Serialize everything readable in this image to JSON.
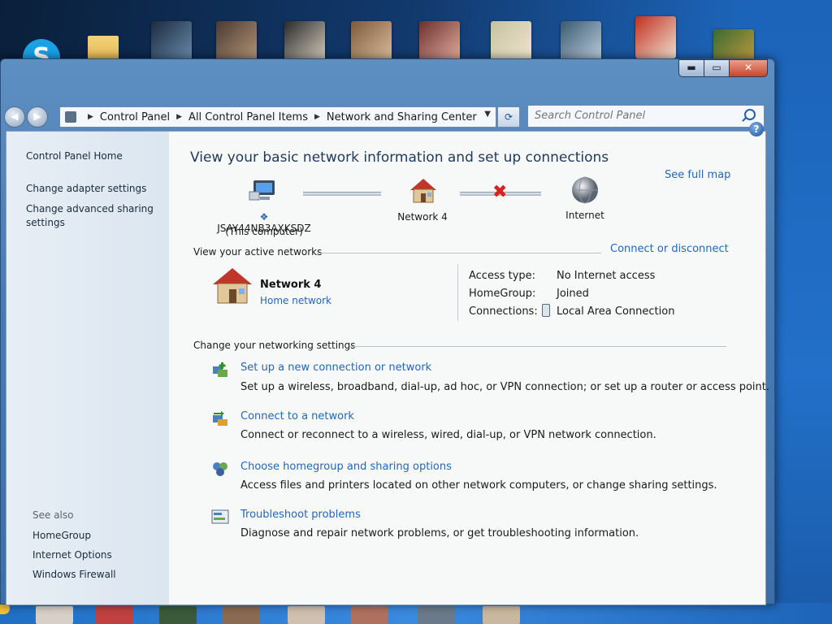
{
  "window": {
    "caption_buttons": {
      "minimize": "▬",
      "maximize": "▭",
      "close": "✕"
    }
  },
  "navbar": {
    "breadcrumbs": [
      "Control Panel",
      "All Control Panel Items",
      "Network and Sharing Center"
    ],
    "search_placeholder": "Search Control Panel"
  },
  "sidebar": {
    "home": "Control Panel Home",
    "links": [
      "Change adapter settings",
      "Change advanced sharing settings"
    ],
    "see_also_heading": "See also",
    "see_also": [
      "HomeGroup",
      "Internet Options",
      "Windows Firewall"
    ]
  },
  "main": {
    "title": "View your basic network information and set up connections",
    "see_full_map": "See full map",
    "map": {
      "computer_name": "JSAY44NB3AXKSDZ",
      "computer_sub": "(This computer)",
      "network": "Network 4",
      "internet": "Internet",
      "link_to_internet_status": "broken"
    },
    "active_networks_heading": "View your active networks",
    "connect_or_disconnect": "Connect or disconnect",
    "active_network": {
      "name": "Network  4",
      "type": "Home network",
      "access_type_label": "Access type:",
      "access_type_value": "No Internet access",
      "homegroup_label": "HomeGroup:",
      "homegroup_value": "Joined",
      "connections_label": "Connections:",
      "connections_value": "Local Area Connection"
    },
    "change_settings_heading": "Change your networking settings",
    "tasks": [
      {
        "title": "Set up a new connection or network",
        "desc": "Set up a wireless, broadband, dial-up, ad hoc, or VPN connection; or set up a router or access point.",
        "icon": "new-connection-icon"
      },
      {
        "title": "Connect to a network",
        "desc": "Connect or reconnect to a wireless, wired, dial-up, or VPN network connection.",
        "icon": "connect-network-icon"
      },
      {
        "title": "Choose homegroup and sharing options",
        "desc": "Access files and printers located on other network computers, or change sharing settings.",
        "icon": "homegroup-icon"
      },
      {
        "title": "Troubleshoot problems",
        "desc": "Diagnose and repair network problems, or get troubleshooting information.",
        "icon": "troubleshoot-icon"
      }
    ]
  },
  "colors": {
    "link": "#2566b8",
    "title": "#1e395b",
    "error_x": "#d3261f"
  }
}
